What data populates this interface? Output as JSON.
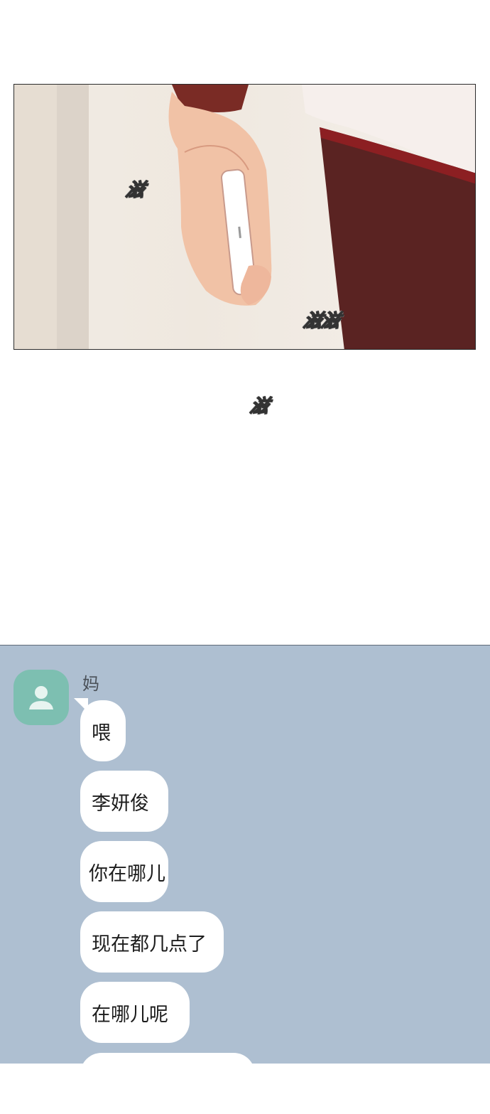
{
  "comic_panel": {
    "sfx": [
      "滋",
      "滋滋",
      "滋"
    ]
  },
  "chat": {
    "sender_name": "妈",
    "messages": [
      "喂",
      "李妍俊",
      "你在哪儿",
      "现在都几点了",
      "在哪儿呢"
    ],
    "colors": {
      "background": "#aebfd1",
      "bubble": "#ffffff",
      "avatar": "#7dbfb1"
    },
    "avatar_icon": "person-icon"
  }
}
